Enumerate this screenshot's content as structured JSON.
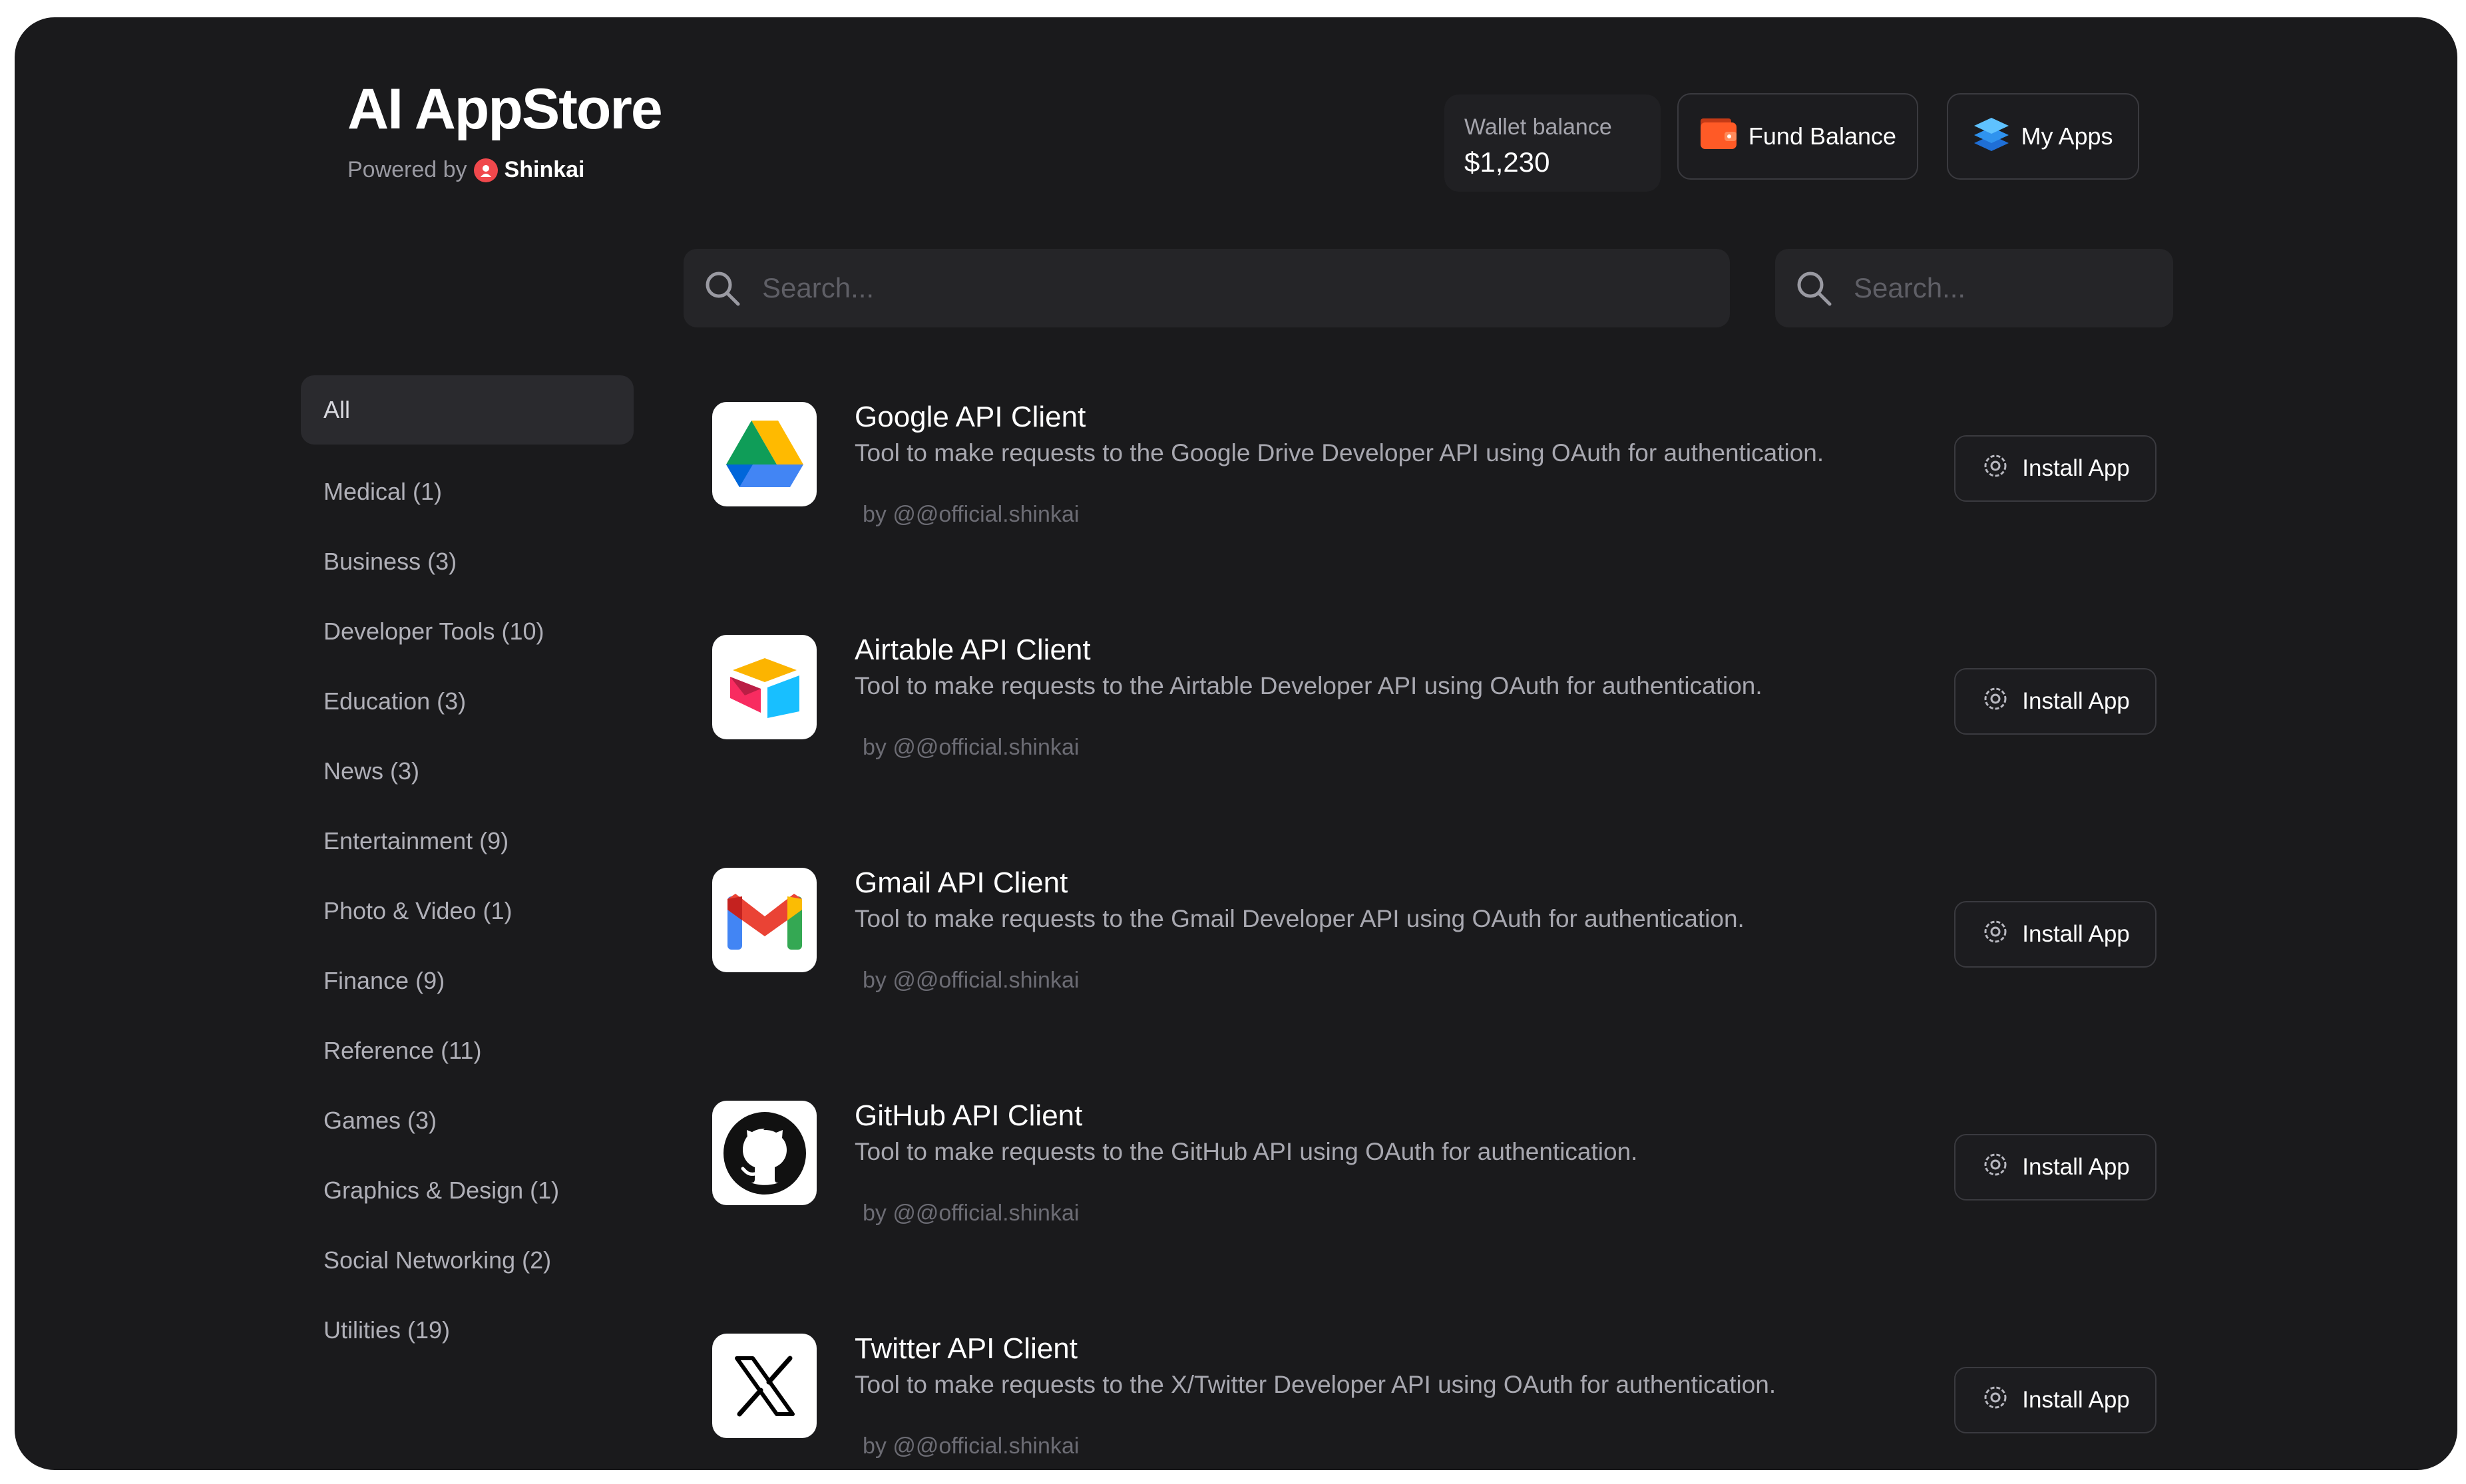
{
  "header": {
    "title": "AI AppStore",
    "powered_by": "Powered by",
    "brand": "Shinkai",
    "wallet_label": "Wallet balance",
    "wallet_value": "$1,230",
    "fund_label": "Fund Balance",
    "myapps_label": "My Apps"
  },
  "search": {
    "placeholder_main": "Search...",
    "placeholder_side": "Search..."
  },
  "sidebar": {
    "items": [
      {
        "label": "All",
        "active": true
      },
      {
        "label": "Medical (1)"
      },
      {
        "label": "Business (3)"
      },
      {
        "label": "Developer Tools (10)"
      },
      {
        "label": "Education (3)"
      },
      {
        "label": "News (3)"
      },
      {
        "label": "Entertainment (9)"
      },
      {
        "label": "Photo & Video (1)"
      },
      {
        "label": "Finance (9)"
      },
      {
        "label": "Reference (11)"
      },
      {
        "label": "Games (3)"
      },
      {
        "label": "Graphics & Design (1)"
      },
      {
        "label": "Social Networking (2)"
      },
      {
        "label": "Utilities (19)"
      }
    ]
  },
  "apps": [
    {
      "name": "Google API Client",
      "description": "Tool to make requests to the Google Drive Developer API using OAuth for authentication.",
      "author": "by @@official.shinkai",
      "button": "Install App",
      "icon": "google-drive-icon"
    },
    {
      "name": "Airtable API Client",
      "description": "Tool to make requests to the Airtable Developer API using OAuth for authentication.",
      "author": "by @@official.shinkai",
      "button": "Install App",
      "icon": "airtable-icon"
    },
    {
      "name": "Gmail API Client",
      "description": "Tool to make requests to the Gmail Developer API using OAuth for authentication.",
      "author": "by @@official.shinkai",
      "button": "Install App",
      "icon": "gmail-icon"
    },
    {
      "name": "GitHub API Client",
      "description": "Tool to make requests to the GitHub API using OAuth for authentication.",
      "author": "by @@official.shinkai",
      "button": "Install App",
      "icon": "github-icon"
    },
    {
      "name": "Twitter API Client",
      "description": "Tool to make requests to the X/Twitter Developer API using OAuth for authentication.",
      "author": "by @@official.shinkai",
      "button": "Install App",
      "icon": "x-twitter-icon"
    }
  ]
}
